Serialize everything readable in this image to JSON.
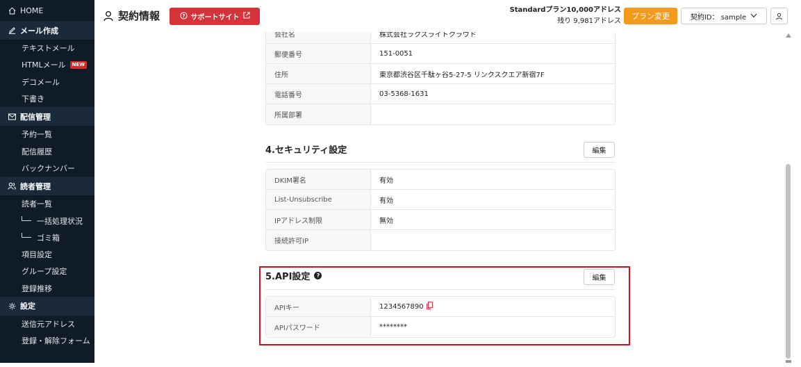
{
  "sidebar": {
    "home": "HOME",
    "sections": [
      {
        "label": "メール作成",
        "icon": "pencil-icon",
        "items": [
          {
            "label": "テキストメール"
          },
          {
            "label": "HTMLメール",
            "badge": "NEW"
          },
          {
            "label": "デコメール"
          },
          {
            "label": "下書き"
          }
        ]
      },
      {
        "label": "配信管理",
        "icon": "envelope-icon",
        "items": [
          {
            "label": "予約一覧"
          },
          {
            "label": "配信履歴"
          },
          {
            "label": "バックナンバー"
          }
        ]
      },
      {
        "label": "読者管理",
        "icon": "users-icon",
        "items": [
          {
            "label": "読者一覧"
          },
          {
            "label": "一括処理状況"
          },
          {
            "label": "ゴミ箱"
          },
          {
            "label": "項目設定"
          },
          {
            "label": "グループ設定"
          },
          {
            "label": "登録推移"
          }
        ]
      },
      {
        "label": "設定",
        "icon": "gear-icon",
        "items": [
          {
            "label": "送信元アドレス"
          },
          {
            "label": "登録・解除フォーム"
          }
        ]
      }
    ]
  },
  "header": {
    "title": "契約情報",
    "support_label": "サポートサイト",
    "plan": "Standardプラン10,000アドレス",
    "remaining": "残り 9,981アドレス",
    "plan_change": "プラン変更",
    "account_label": "契約ID： sample"
  },
  "company_table": [
    {
      "label": "会社名",
      "value": "株式会社ラクスライトクラウド"
    },
    {
      "label": "郵便番号",
      "value": "151-0051"
    },
    {
      "label": "住所",
      "value": "東京都渋谷区千駄ヶ谷5-27-5 リンクスクエア新宿7F"
    },
    {
      "label": "電話番号",
      "value": "03-5368-1631"
    },
    {
      "label": "所属部署",
      "value": ""
    }
  ],
  "security": {
    "title": "4.セキュリティ設定",
    "edit": "編集",
    "rows": [
      {
        "label": "DKIM署名",
        "value": "有効"
      },
      {
        "label": "List-Unsubscribe",
        "value": "有効"
      },
      {
        "label": "IPアドレス制限",
        "value": "無効"
      },
      {
        "label": "接続許可IP",
        "value": ""
      }
    ]
  },
  "api": {
    "title": "5.API設定",
    "edit": "編集",
    "rows": [
      {
        "label": "APIキー",
        "value": "1234567890"
      },
      {
        "label": "APIパスワード",
        "value": "********"
      }
    ]
  },
  "colors": {
    "sidebar_bg": "#0f1b26",
    "section_bg": "#1a2a3a",
    "support_red": "#d6323a",
    "plan_orange": "#f39a1b",
    "highlight_red": "#c8181e",
    "new_badge": "#d92b2b",
    "copy_icon": "#d6323a"
  }
}
